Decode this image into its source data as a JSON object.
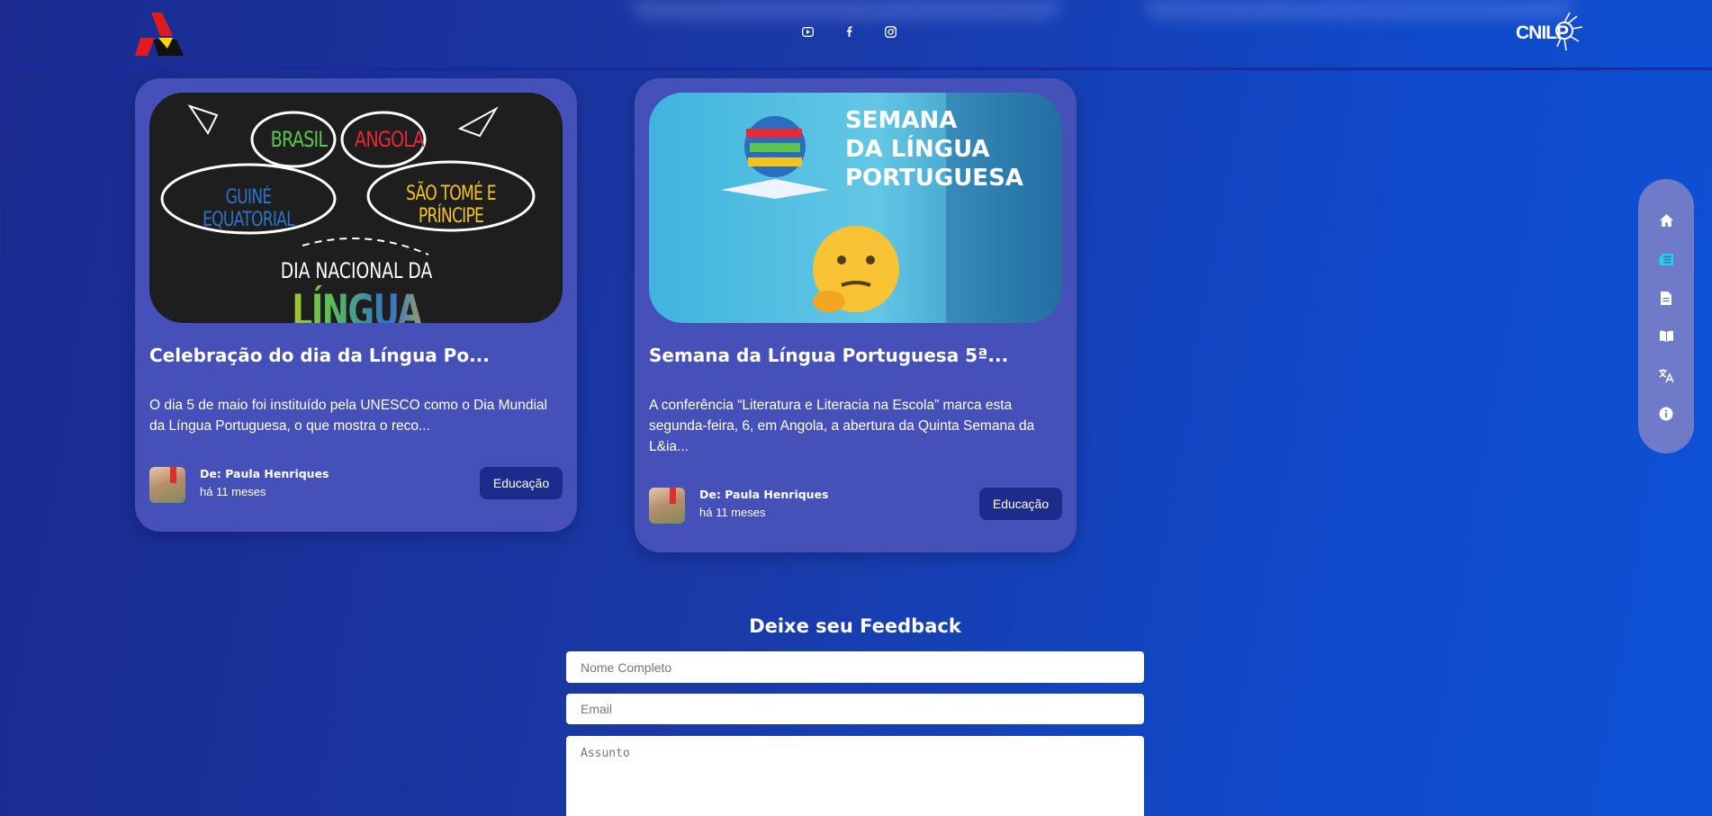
{
  "header": {
    "logo_left": "aaa-logo",
    "social": [
      "youtube-icon",
      "facebook-icon",
      "instagram-icon"
    ],
    "logo_right_text": "CNILP"
  },
  "cards": [
    {
      "image_text": {
        "badges": [
          "BRASIL",
          "ANGOLA",
          "GUINÉ EQUATORIAL",
          "SÃO TOMÉ E PRÍNCIPE"
        ],
        "line1": "DIA NACIONAL DA",
        "line2": "LÍNGUA PORTUGUESA"
      },
      "title": "Celebração do dia da Língua Po...",
      "excerpt": "O dia 5 de maio foi instituído pela UNESCO como o Dia Mundial da Língua Portuguesa, o que mostra o reco...",
      "author": "De: Paula Henriques",
      "time": "há 11 meses",
      "tag": "Educação"
    },
    {
      "image_text": {
        "line1": "SEMANA",
        "line2": "DA LÍNGUA",
        "line3": "PORTUGUESA"
      },
      "title": "Semana da Língua Portuguesa 5ª...",
      "excerpt": "A conferência “Literatura e Literacia na Escola” marca esta segunda-feira, 6, em Angola, a abertura da Quinta Semana da L&ia...",
      "author": "De: Paula Henriques",
      "time": "há 11 meses",
      "tag": "Educação"
    }
  ],
  "sidenav": {
    "items": [
      "home-icon",
      "news-icon",
      "document-icon",
      "book-icon",
      "translate-icon",
      "info-icon"
    ],
    "active_color": "#22d3ee"
  },
  "feedback": {
    "title": "Deixe seu Feedback",
    "name_placeholder": "Nome Completo",
    "email_placeholder": "Email",
    "subject_placeholder": "Assunto"
  }
}
